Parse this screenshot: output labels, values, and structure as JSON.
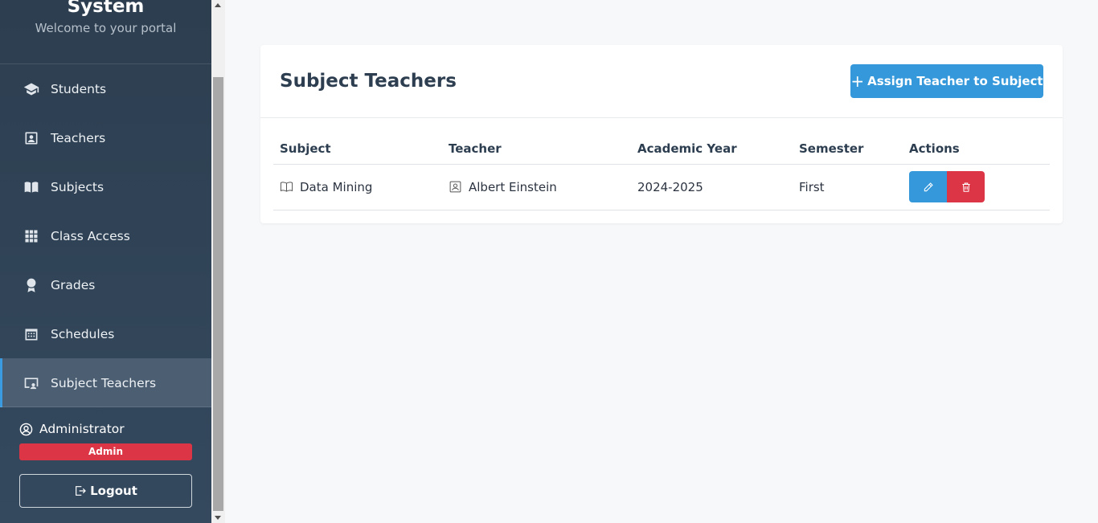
{
  "sidebar": {
    "brand_title": "System",
    "brand_subtitle": "Welcome to your portal",
    "items": [
      {
        "label": "Students",
        "icon": "graduation-cap-icon"
      },
      {
        "label": "Teachers",
        "icon": "person-badge-icon"
      },
      {
        "label": "Subjects",
        "icon": "book-icon"
      },
      {
        "label": "Class Access",
        "icon": "grid-icon"
      },
      {
        "label": "Grades",
        "icon": "award-icon"
      },
      {
        "label": "Schedules",
        "icon": "calendar-icon"
      },
      {
        "label": "Subject Teachers",
        "icon": "person-video-icon",
        "active": true
      }
    ],
    "user": {
      "name": "Administrator",
      "role": "Admin"
    },
    "logout_label": "Logout"
  },
  "main": {
    "title": "Subject Teachers",
    "assign_button": "Assign Teacher to Subject",
    "table": {
      "columns": [
        "Subject",
        "Teacher",
        "Academic Year",
        "Semester",
        "Actions"
      ],
      "rows": [
        {
          "subject": "Data Mining",
          "teacher": "Albert Einstein",
          "academic_year": "2024-2025",
          "semester": "First"
        }
      ]
    }
  },
  "colors": {
    "primary": "#3498db",
    "danger": "#dc3545",
    "sidebar_bg": "#2d3e50"
  }
}
